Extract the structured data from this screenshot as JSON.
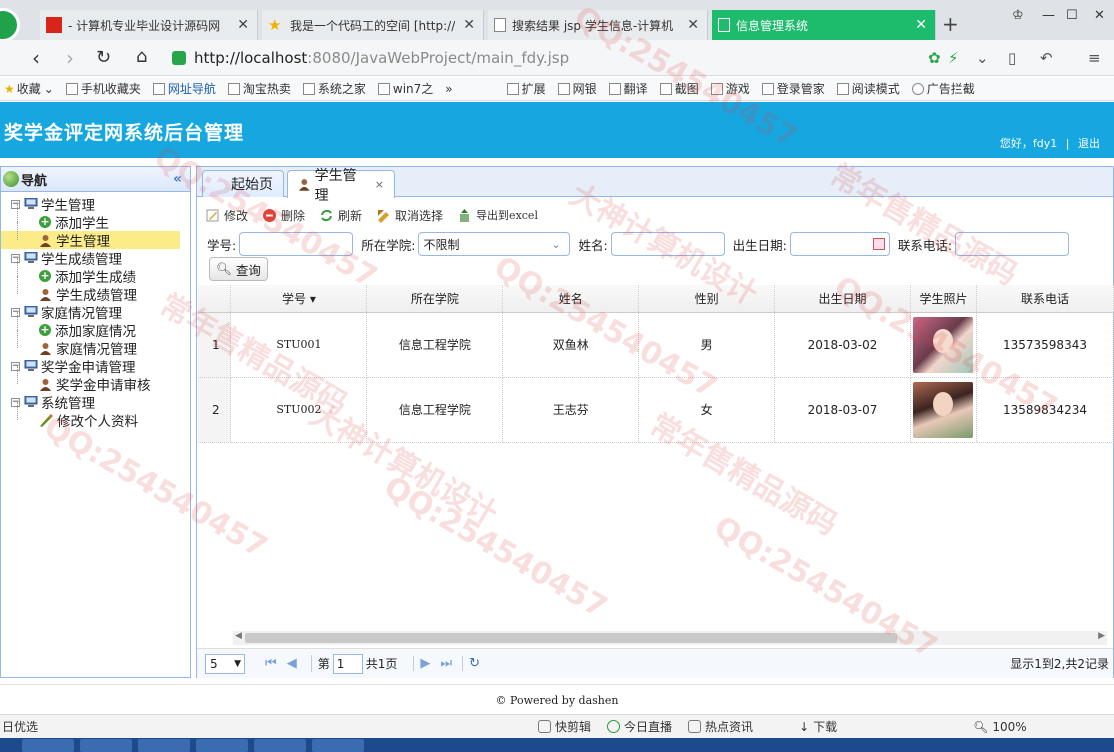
{
  "browser": {
    "tabs": [
      {
        "title": "- 计算机专业毕业设计源码网",
        "active": false
      },
      {
        "title": "我是一个代码工的空间 [http://",
        "active": false
      },
      {
        "title": "搜索结果 jsp 学生信息-计算机",
        "active": false
      },
      {
        "title": "信息管理系统",
        "active": true
      }
    ],
    "url_host": "http://localhost",
    "url_path": ":8080/JavaWebProject/main_fdy.jsp",
    "bookmarks": [
      "收藏",
      "手机收藏夹",
      "网址导航",
      "淘宝热卖",
      "系统之家",
      "win7之",
      "»",
      "扩展",
      "网银",
      "翻译",
      "截图",
      "游戏",
      "登录管家",
      "阅读模式",
      "广告拦截"
    ]
  },
  "header": {
    "title": "奖学金评定网系统后台管理",
    "welcome": "您好，fdy1",
    "separator": "|",
    "logout": "退出",
    "bg_color": "#16a7e1"
  },
  "nav": {
    "title": "导航",
    "collapse_glyph": "«",
    "groups": [
      {
        "label": "学生管理",
        "children": [
          {
            "label": "添加学生",
            "icon": "add-icon"
          },
          {
            "label": "学生管理",
            "icon": "user-icon",
            "selected": true
          }
        ]
      },
      {
        "label": "学生成绩管理",
        "children": [
          {
            "label": "添加学生成绩",
            "icon": "add-icon"
          },
          {
            "label": "学生成绩管理",
            "icon": "user-icon"
          }
        ]
      },
      {
        "label": "家庭情况管理",
        "children": [
          {
            "label": "添加家庭情况",
            "icon": "add-icon"
          },
          {
            "label": "家庭情况管理",
            "icon": "user-icon"
          }
        ]
      },
      {
        "label": "奖学金申请管理",
        "children": [
          {
            "label": "奖学金申请审核",
            "icon": "user-icon"
          }
        ]
      },
      {
        "label": "系统管理",
        "children": [
          {
            "label": "修改个人资料",
            "icon": "edit-icon"
          }
        ]
      }
    ]
  },
  "main_tabs": [
    {
      "label": "起始页",
      "active": false
    },
    {
      "label": "学生管理",
      "active": true,
      "close": "×"
    }
  ],
  "toolbar": {
    "edit": "修改",
    "delete": "删除",
    "refresh": "刷新",
    "unselect": "取消选择",
    "export": "导出到excel"
  },
  "search": {
    "student_no_label": "学号:",
    "college_label": "所在学院:",
    "college_value": "不限制",
    "name_label": "姓名:",
    "birth_label": "出生日期:",
    "phone_label": "联系电话:",
    "query_button": "查询"
  },
  "grid": {
    "columns": [
      "学号 ▾",
      "所在学院",
      "姓名",
      "性别",
      "出生日期",
      "学生照片",
      "联系电话"
    ],
    "rows": [
      {
        "n": "1",
        "no": "STU001",
        "college": "信息工程学院",
        "name": "双鱼林",
        "sex": "男",
        "birth": "2018-03-02",
        "phone": "13573598343"
      },
      {
        "n": "2",
        "no": "STU002",
        "college": "信息工程学院",
        "name": "王志芬",
        "sex": "女",
        "birth": "2018-03-07",
        "phone": "13589834234"
      }
    ]
  },
  "pager": {
    "page_size": "5",
    "page_prefix": "第",
    "page_value": "1",
    "page_total": "共1页",
    "info": "显示1到2,共2记录"
  },
  "footer": "© Powered by dashen",
  "statusbar": {
    "left": "日优选",
    "items": [
      "快剪辑",
      "今日直播",
      "热点资讯",
      "下载",
      "100%"
    ]
  },
  "watermarks": [
    "QQ:254540457",
    "大神计算机设计",
    "常年售精品源码"
  ]
}
